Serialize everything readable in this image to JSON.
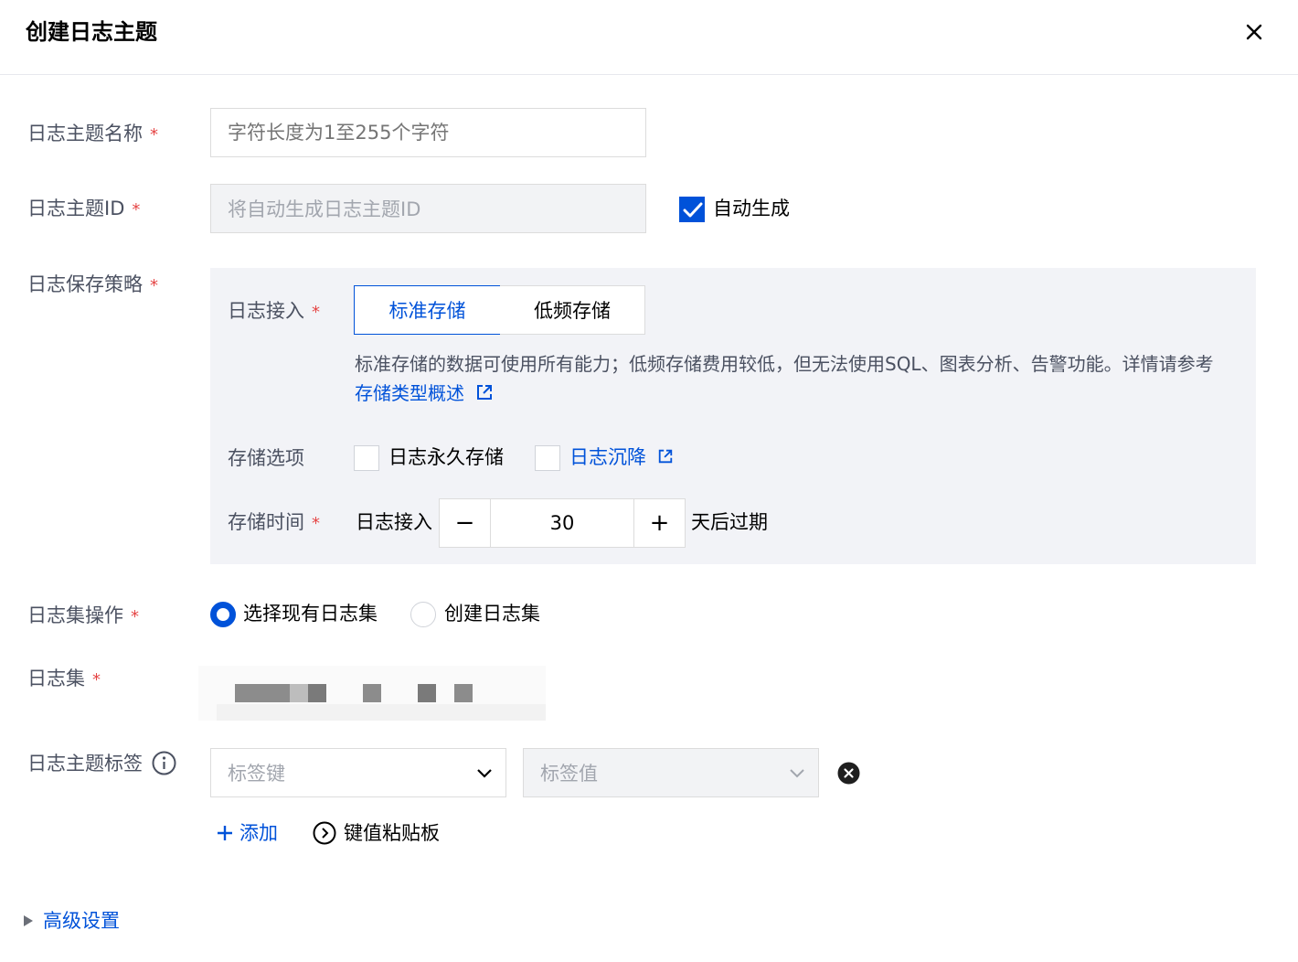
{
  "dialog": {
    "title": "创建日志主题"
  },
  "fields": {
    "name": {
      "label": "日志主题名称",
      "required": "*",
      "placeholder": "字符长度为1至255个字符"
    },
    "id": {
      "label": "日志主题ID",
      "required": "*",
      "placeholder": "将自动生成日志主题ID",
      "auto_label": "自动生成",
      "auto_checked": true
    },
    "retention": {
      "label": "日志保存策略",
      "required": "*",
      "access": {
        "label": "日志接入",
        "required": "*",
        "options": [
          "标准存储",
          "低频存储"
        ],
        "selected": "标准存储"
      },
      "description": "标准存储的数据可使用所有能力；低频存储费用较低，但无法使用SQL、图表分析、告警功能。详情请参考",
      "description_link": "存储类型概述",
      "storage_options": {
        "label": "存储选项",
        "permanent": "日志永久存储",
        "sink": "日志沉降"
      },
      "storage_time": {
        "label": "存储时间",
        "required": "*",
        "prefix": "日志接入",
        "minus": "−",
        "value": "30",
        "plus": "+",
        "suffix": "天后过期"
      }
    },
    "logset_op": {
      "label": "日志集操作",
      "required": "*",
      "options": [
        "选择现有日志集",
        "创建日志集"
      ],
      "selected": "选择现有日志集"
    },
    "logset": {
      "label": "日志集",
      "required": "*"
    },
    "tags": {
      "label": "日志主题标签",
      "key_placeholder": "标签键",
      "value_placeholder": "标签值",
      "add": "添加",
      "clipboard": "键值粘贴板"
    }
  },
  "advanced": {
    "label": "高级设置"
  },
  "colors": {
    "primary": "#0052d9",
    "required": "#e54545",
    "label": "#4b5161",
    "panel": "#f2f3f7"
  }
}
